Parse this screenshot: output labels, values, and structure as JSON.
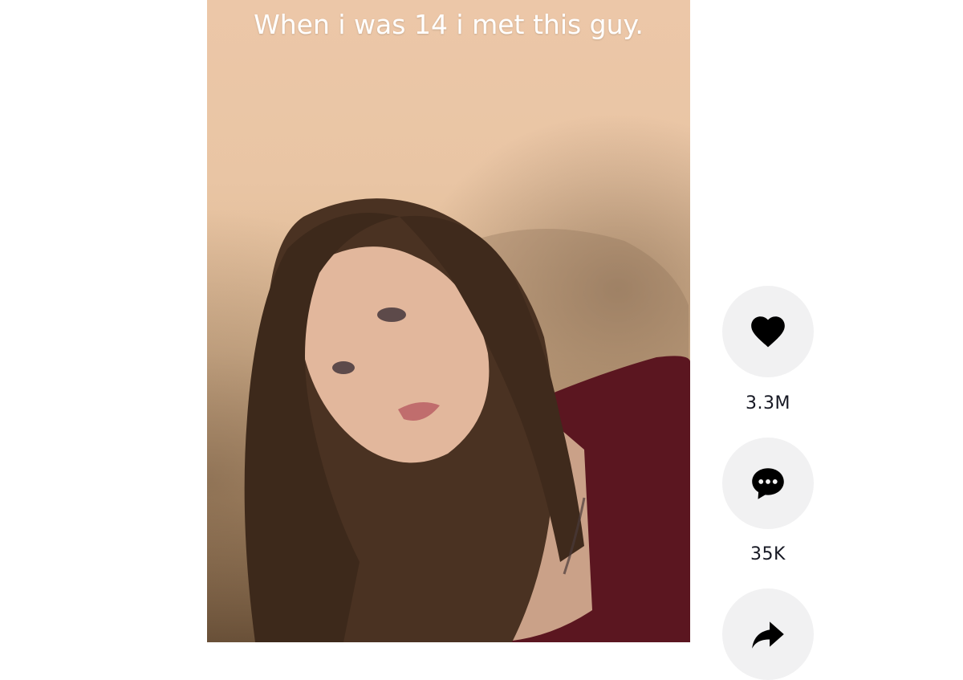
{
  "video": {
    "caption": "When i was 14 i met this guy."
  },
  "actions": {
    "like": {
      "icon": "heart-icon",
      "count": "3.3M"
    },
    "comment": {
      "icon": "comment-icon",
      "count": "35K"
    },
    "share": {
      "icon": "share-icon"
    }
  },
  "colors": {
    "button_bg": "#f1f1f2",
    "icon": "#000000",
    "count_text": "#161823"
  }
}
